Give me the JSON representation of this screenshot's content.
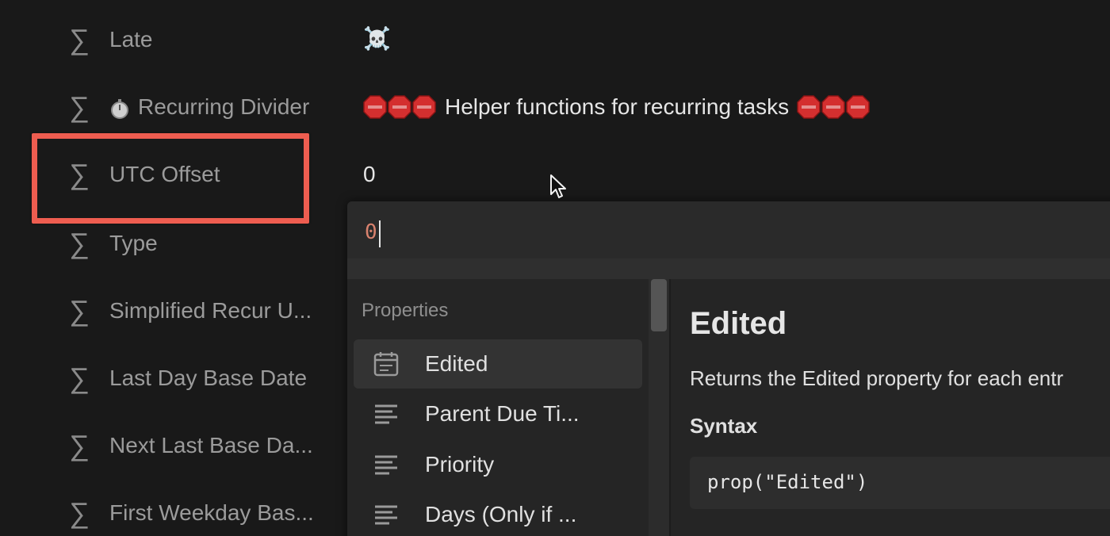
{
  "properties_panel": {
    "rows": [
      {
        "label": "Late",
        "value": "☠️"
      },
      {
        "label": "Recurring Divider",
        "value_text": "Helper functions for recurring tasks",
        "icon": "stopwatch-icon"
      },
      {
        "label": "UTC Offset",
        "value": "0"
      },
      {
        "label": "Type"
      },
      {
        "label": "Simplified Recur U..."
      },
      {
        "label": "Last Day Base Date"
      },
      {
        "label": "Next Last Base Da..."
      },
      {
        "label": "First Weekday Bas..."
      }
    ],
    "row_icon": "sigma-icon",
    "highlight_color": "#ee5d50",
    "stop_sign_color": "#e03030"
  },
  "formula_editor": {
    "input_value": "0",
    "input_text_color": "#d9826e",
    "list": {
      "section_heading": "Properties",
      "items": [
        {
          "label": "Edited",
          "icon": "calendar-icon",
          "selected": true
        },
        {
          "label": "Parent Due Ti...",
          "icon": "text-lines-icon",
          "selected": false
        },
        {
          "label": "Priority",
          "icon": "text-lines-icon",
          "selected": false
        },
        {
          "label": "Days (Only if ...",
          "icon": "text-lines-icon",
          "selected": false
        }
      ]
    },
    "detail": {
      "title": "Edited",
      "description": "Returns the Edited property for each entr",
      "syntax_heading": "Syntax",
      "syntax_code": "prop(\"Edited\")"
    }
  }
}
